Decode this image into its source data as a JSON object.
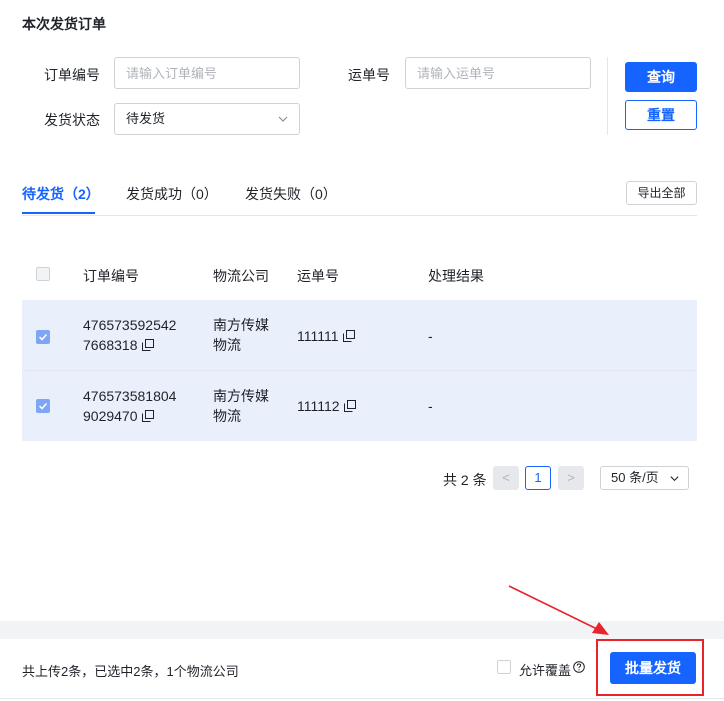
{
  "section": {
    "title": "本次发货订单"
  },
  "filters": {
    "order_no_label": "订单编号",
    "order_no_placeholder": "请输入订单编号",
    "waybill_label": "运单号",
    "waybill_placeholder": "请输入运单号",
    "status_label": "发货状态",
    "status_value": "待发货",
    "query_button": "查询",
    "reset_button": "重置"
  },
  "tabs": [
    {
      "label": "待发货（2）"
    },
    {
      "label": "发货成功（0）"
    },
    {
      "label": "发货失败（0）"
    }
  ],
  "export_button": "导出全部",
  "table": {
    "headers": [
      "订单编号",
      "物流公司",
      "运单号",
      "处理结果"
    ],
    "rows": [
      {
        "order_line1": "476573592542",
        "order_line2": "7668318",
        "company_line1": "南方传媒",
        "company_line2": "物流",
        "waybill": "111111",
        "result": "-",
        "checked": true
      },
      {
        "order_line1": "476573581804",
        "order_line2": "9029470",
        "company_line1": "南方传媒",
        "company_line2": "物流",
        "waybill": "111112",
        "result": "-",
        "checked": true
      }
    ]
  },
  "pagination": {
    "total": "共 2 条",
    "prev": "<",
    "current": "1",
    "next": ">",
    "page_size": "50 条/页"
  },
  "footer": {
    "summary": "共上传2条，已选中2条，1个物流公司",
    "allow_override": "允许覆盖",
    "allow_override_checked": false,
    "batch_button": "批量发货"
  },
  "colors": {
    "primary": "#1664ff",
    "annotation": "#e8242a"
  }
}
